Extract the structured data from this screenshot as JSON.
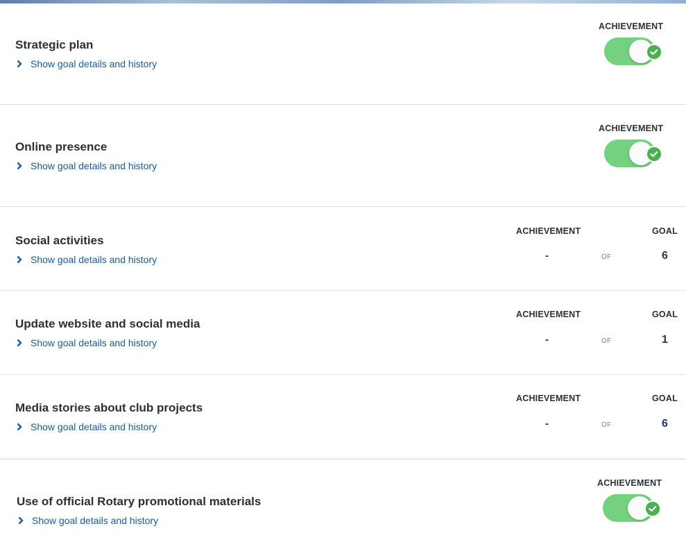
{
  "colors": {
    "toggle_track": "#74d17f",
    "toggle_check": "#4caf50",
    "link": "#1a5a96",
    "value": "#1c3a63"
  },
  "link_label": "Show goal details and history",
  "goals": [
    {
      "title": "Strategic plan",
      "type": "toggle",
      "achievement_label": "ACHIEVEMENT",
      "achieved": true
    },
    {
      "title": "Online presence",
      "type": "toggle",
      "achievement_label": "ACHIEVEMENT",
      "achieved": true
    },
    {
      "title": "Social activities",
      "type": "numeric",
      "achievement_label": "ACHIEVEMENT",
      "goal_label": "GOAL",
      "achievement": "-",
      "of_label": "OF",
      "goal": "6"
    },
    {
      "title": "Update website and social media",
      "type": "numeric",
      "achievement_label": "ACHIEVEMENT",
      "goal_label": "GOAL",
      "achievement": "-",
      "of_label": "OF",
      "goal": "1"
    },
    {
      "title": "Media stories about club projects",
      "type": "numeric",
      "achievement_label": "ACHIEVEMENT",
      "goal_label": "GOAL",
      "achievement": "-",
      "of_label": "OF",
      "goal": "6"
    },
    {
      "title": "Use of official Rotary promotional materials",
      "type": "toggle",
      "achievement_label": "ACHIEVEMENT",
      "achieved": true
    }
  ]
}
